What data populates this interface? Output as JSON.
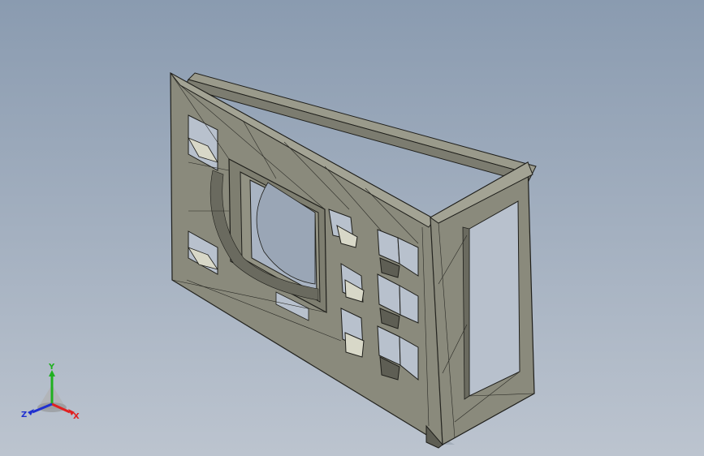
{
  "viewport": {
    "background_top": "#8a9bb0",
    "background_bottom": "#bcc4cf"
  },
  "model": {
    "face_color": "#8a8a7c",
    "face_light": "#a3a394",
    "face_dark": "#5e5e54",
    "edge_color": "#1e1e1a"
  },
  "triad": {
    "x_label": "X",
    "y_label": "Y",
    "z_label": "Z",
    "x_color": "#e02020",
    "y_color": "#20b020",
    "z_color": "#2030d0"
  }
}
